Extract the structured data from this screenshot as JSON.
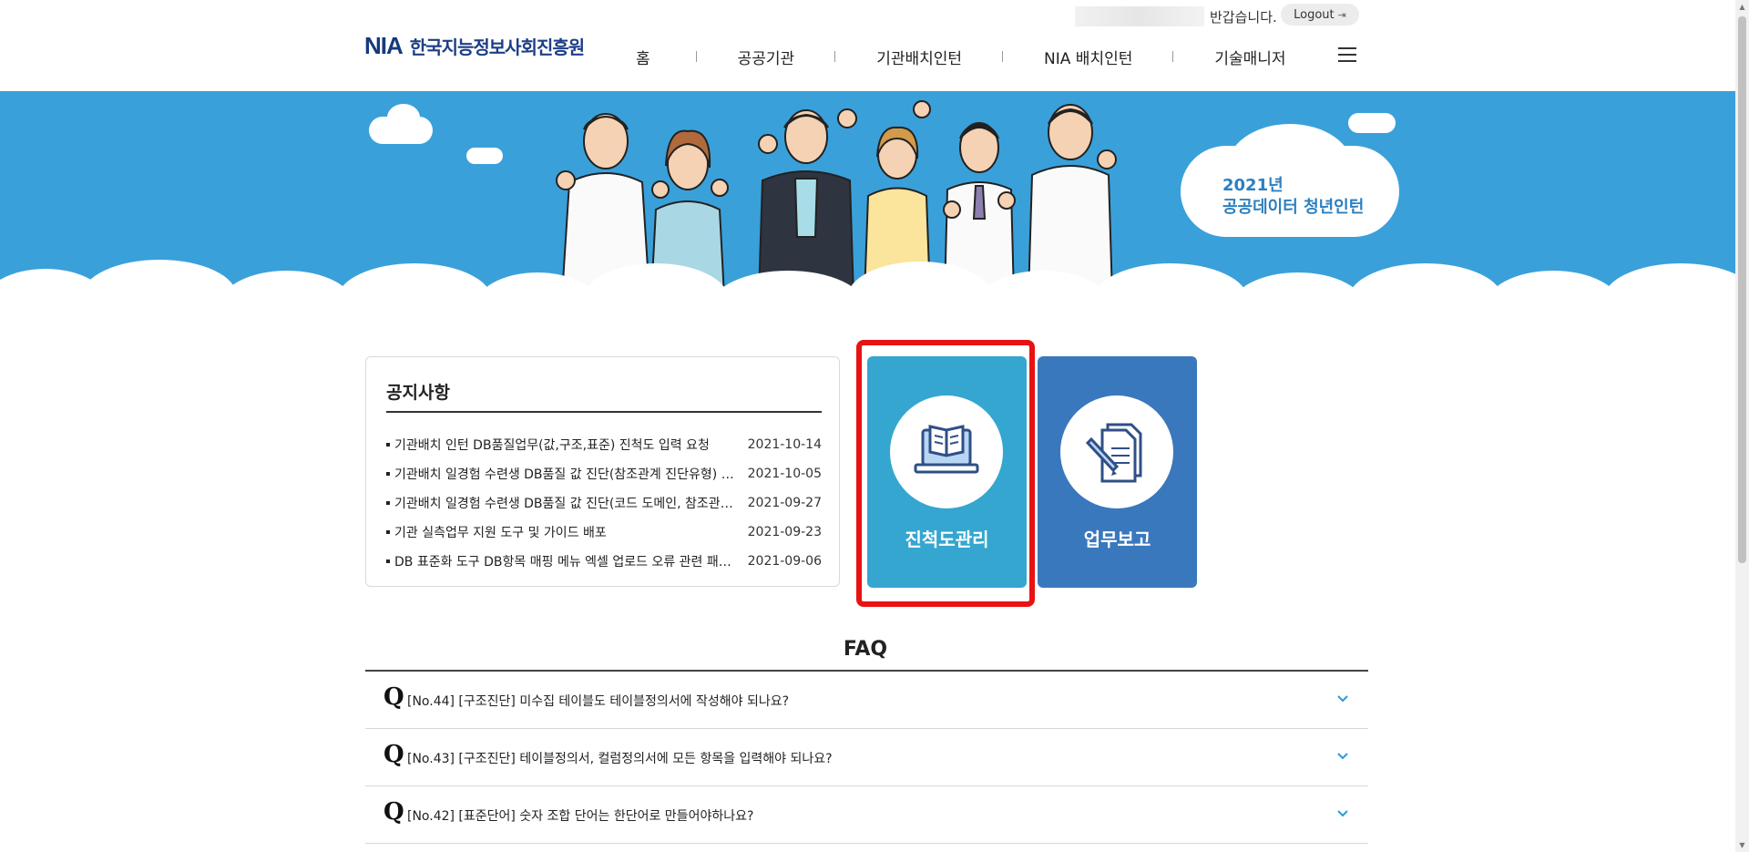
{
  "header": {
    "greeting": "반갑습니다.",
    "logout_label": "Logout",
    "logo_mark": "NIA",
    "logo_text": "한국지능정보사회진흥원",
    "nav": [
      {
        "label": "홈"
      },
      {
        "label": "공공기관"
      },
      {
        "label": "기관배치인턴"
      },
      {
        "label": "NIA 배치인턴"
      },
      {
        "label": "기술매니저"
      }
    ]
  },
  "banner": {
    "line1": "2021년",
    "line2": "공공데이터 청년인턴",
    "bg_color": "#3aa0da"
  },
  "notice": {
    "title": "공지사항",
    "items": [
      {
        "text": "기관배치 인턴 DB품질업무(값,구조,표준) 진척도 입력 요청",
        "date": "2021-10-14"
      },
      {
        "text": "기관배치 일경험 수련생 DB품질 값 진단(참조관계 진단유형) …",
        "date": "2021-10-05"
      },
      {
        "text": "기관배치 일경험 수련생 DB품질 값 진단(코드 도메인, 참조관계…",
        "date": "2021-09-27"
      },
      {
        "text": "기관 실측업무 지원 도구 및 가이드 배포",
        "date": "2021-09-23"
      },
      {
        "text": "DB 표준화 도구 DB항목 매핑 메뉴 엑셀 업로드 오류 관련 패치 …",
        "date": "2021-09-06"
      }
    ]
  },
  "tiles": [
    {
      "label": "진척도관리",
      "icon": "laptop-book-icon",
      "color": "#35a6cf"
    },
    {
      "label": "업무보고",
      "icon": "document-pen-icon",
      "color": "#3a78bd"
    }
  ],
  "faq": {
    "title": "FAQ",
    "q_mark": "Q",
    "items": [
      {
        "text": "[No.44] [구조진단] 미수집 테이블도 테이블정의서에 작성해야 되나요?"
      },
      {
        "text": "[No.43] [구조진단] 테이블정의서, 컬럼정의서에 모든 항목을 입력해야 되나요?"
      },
      {
        "text": "[No.42] [표준단어] 숫자 조합 단어는 한단어로 만들어야하나요?"
      }
    ]
  },
  "colors": {
    "highlight": "#e81212",
    "accent": "#35a6cf"
  }
}
